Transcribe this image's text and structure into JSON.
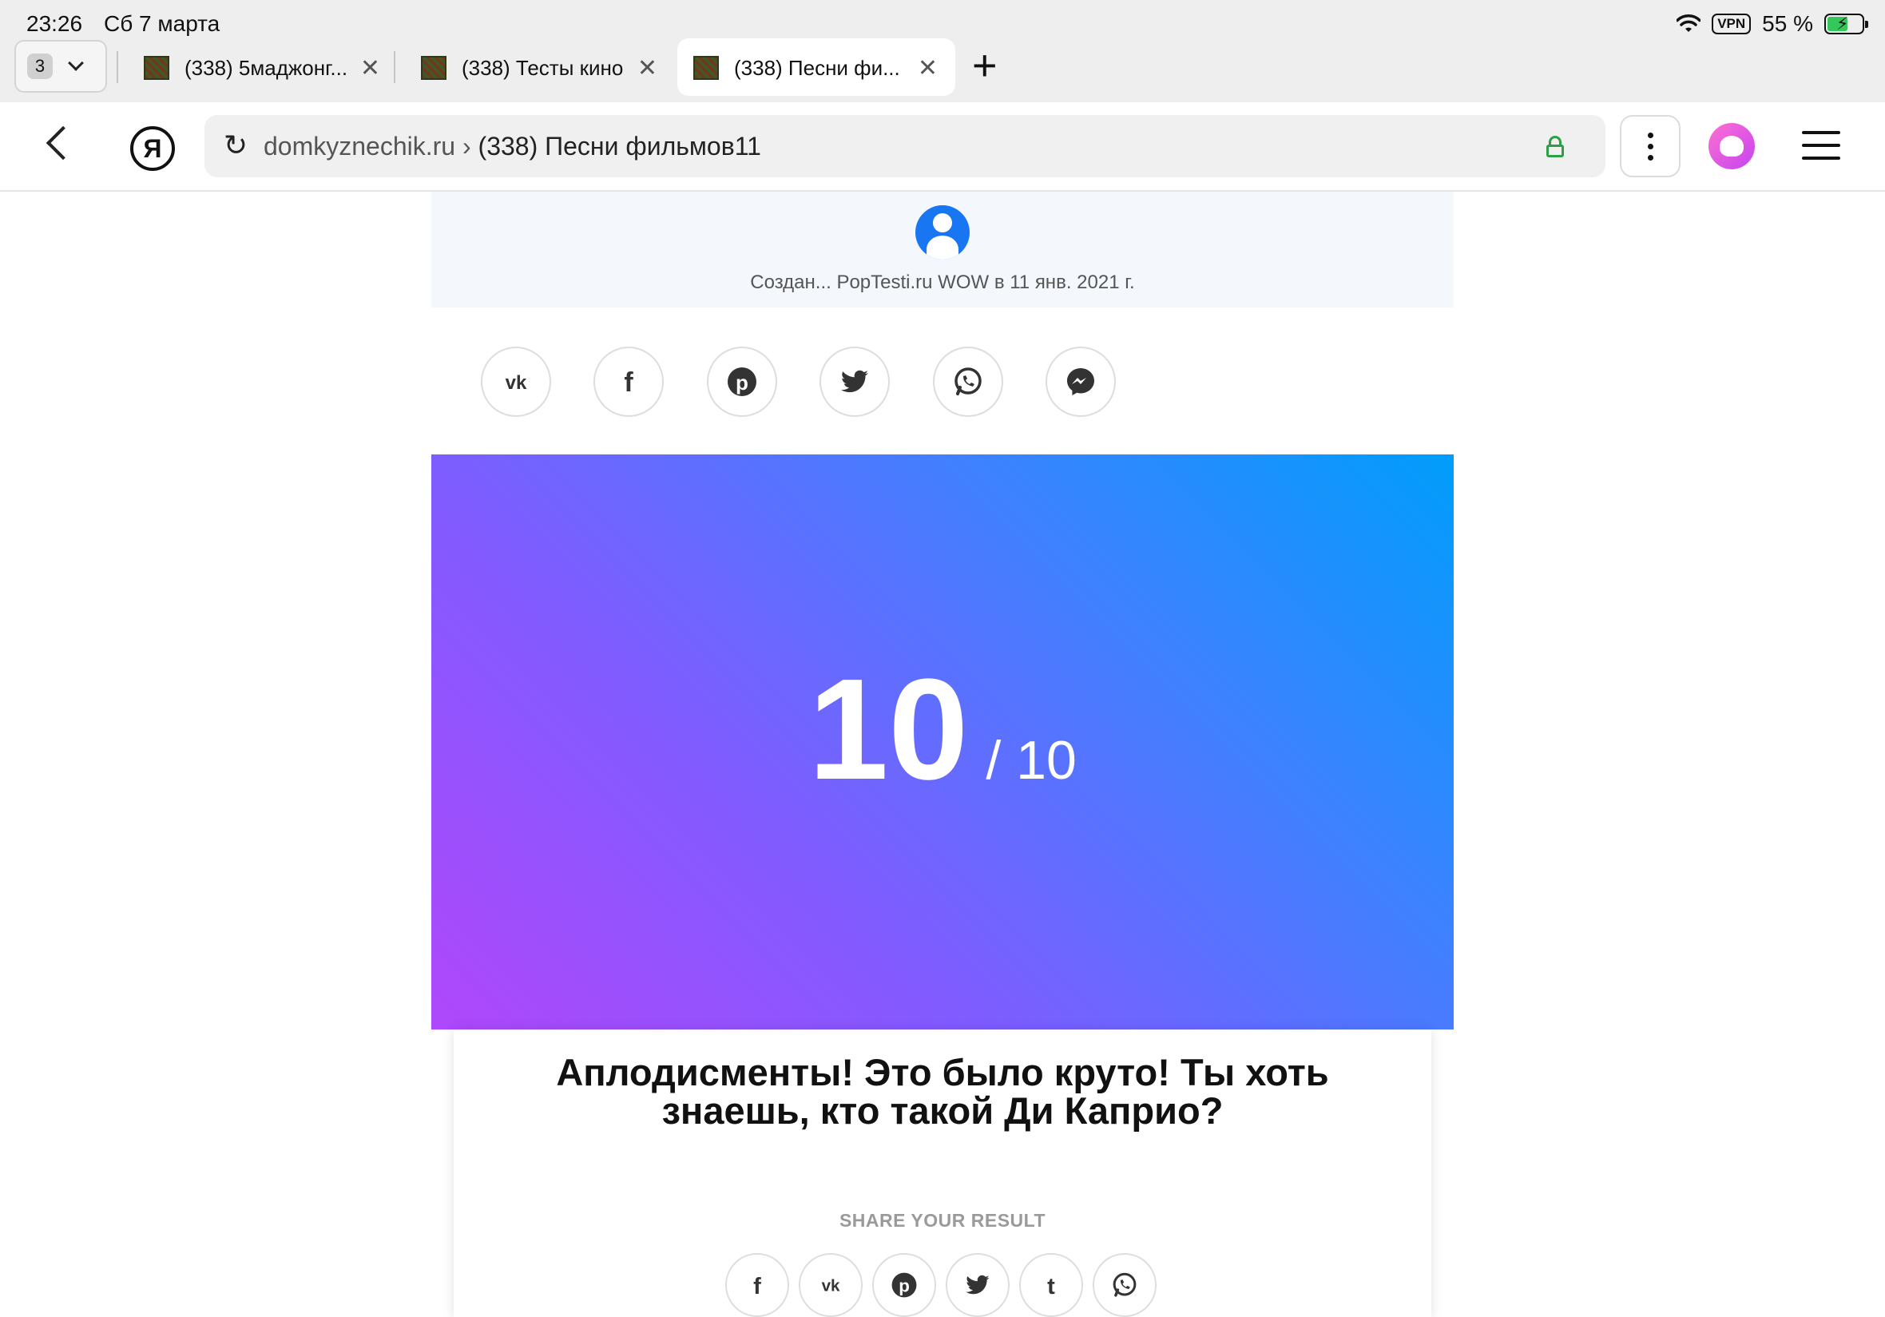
{
  "status_bar": {
    "time": "23:26",
    "date": "Сб 7 марта",
    "vpn": "VPN",
    "battery": "55 %"
  },
  "tabs": {
    "counter": "3",
    "items": [
      {
        "title": "(338) 5маджонг..."
      },
      {
        "title": "(338) Тесты кино"
      },
      {
        "title": "(338) Песни фи..."
      }
    ],
    "new_tab": "+"
  },
  "address_bar": {
    "logo": "Я",
    "domain": "domkyznechik.ru",
    "separator": " › ",
    "page_title": "(338) Песни фильмов11"
  },
  "author": {
    "text": "Создан... PopTesti.ru WOW в 11 янв. 2021 г."
  },
  "share_top": {
    "icons": [
      "vk-icon",
      "facebook-icon",
      "pinterest-icon",
      "twitter-icon",
      "whatsapp-icon",
      "messenger-icon"
    ]
  },
  "result": {
    "score": "10",
    "total": "/ 10",
    "title": "Аплодисменты! Это было круто! Ты хоть знаешь, кто такой Ди Каприо?",
    "gradient": [
      "#b047fb",
      "#009dfb"
    ]
  },
  "share_result": {
    "label": "SHARE YOUR RESULT",
    "icons": [
      "facebook-icon",
      "vk-icon",
      "pinterest-icon",
      "twitter-icon",
      "tumblr-icon",
      "whatsapp-icon"
    ]
  },
  "colors": {
    "lock": "#2f9e44",
    "alice": "#ff6fd1",
    "avatar": "#1976f2"
  }
}
